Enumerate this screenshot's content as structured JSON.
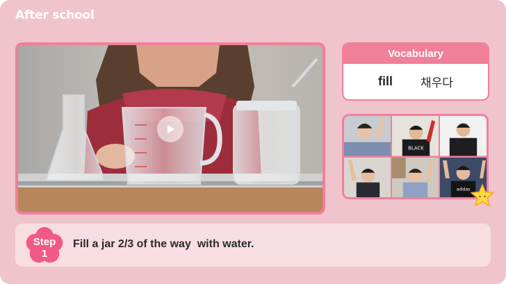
{
  "app": {
    "title": "After school"
  },
  "video": {
    "state": "paused",
    "play_icon": "play-icon"
  },
  "vocabulary": {
    "header": "Vocabulary",
    "word": "fill",
    "translation": "채우다"
  },
  "participants": {
    "count": 6,
    "decoration_icon": "star-icon"
  },
  "step": {
    "label": "Step",
    "number": "1",
    "instruction": "Fill a jar 2/3 of the way  with water."
  },
  "colors": {
    "background": "#f0c4cc",
    "accent": "#f27f9a",
    "step_bar": "#f8dde2",
    "card": "#ffffff"
  }
}
